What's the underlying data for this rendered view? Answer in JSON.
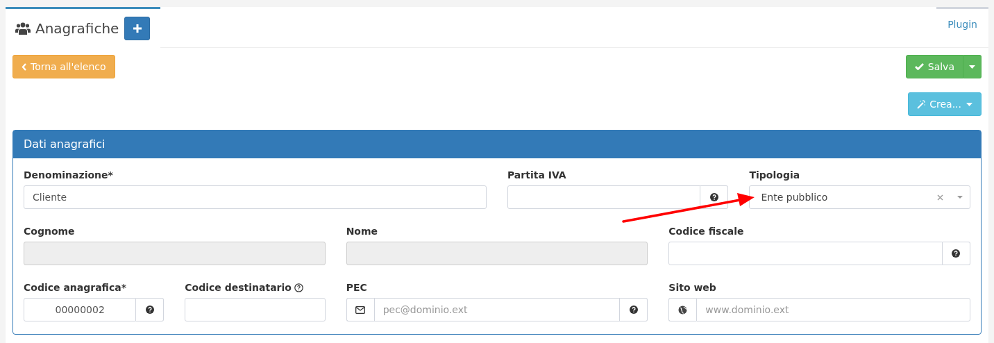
{
  "tabs": [
    {
      "label": "Anagrafiche",
      "selected": true
    },
    {
      "label": "Plugin",
      "selected": false
    }
  ],
  "back_button": "Torna all'elenco",
  "save_button": "Salva",
  "create_button": "Crea...",
  "panel": {
    "title": "Dati anagrafici",
    "fields": [
      {
        "label": "Denominazione*",
        "kind": "text",
        "value": "Cliente"
      },
      {
        "label": "Partita IVA",
        "kind": "help"
      },
      {
        "label": "Tipologia",
        "kind": "select",
        "value": "Ente pubblico"
      },
      {
        "label": "Cognome",
        "kind": "disabled"
      },
      {
        "label": "Nome",
        "kind": "disabled"
      },
      {
        "label": "Codice fiscale",
        "kind": "help"
      },
      {
        "label": "Codice anagrafica*",
        "kind": "help",
        "value": "00000002"
      },
      {
        "label": "Codice destinatario",
        "kind": "text",
        "label_help": true
      },
      {
        "label": "PEC",
        "kind": "email",
        "placeholder": "pec@dominio.ext"
      },
      {
        "label": "Sito web",
        "kind": "web",
        "placeholder": "www.dominio.ext"
      }
    ]
  }
}
